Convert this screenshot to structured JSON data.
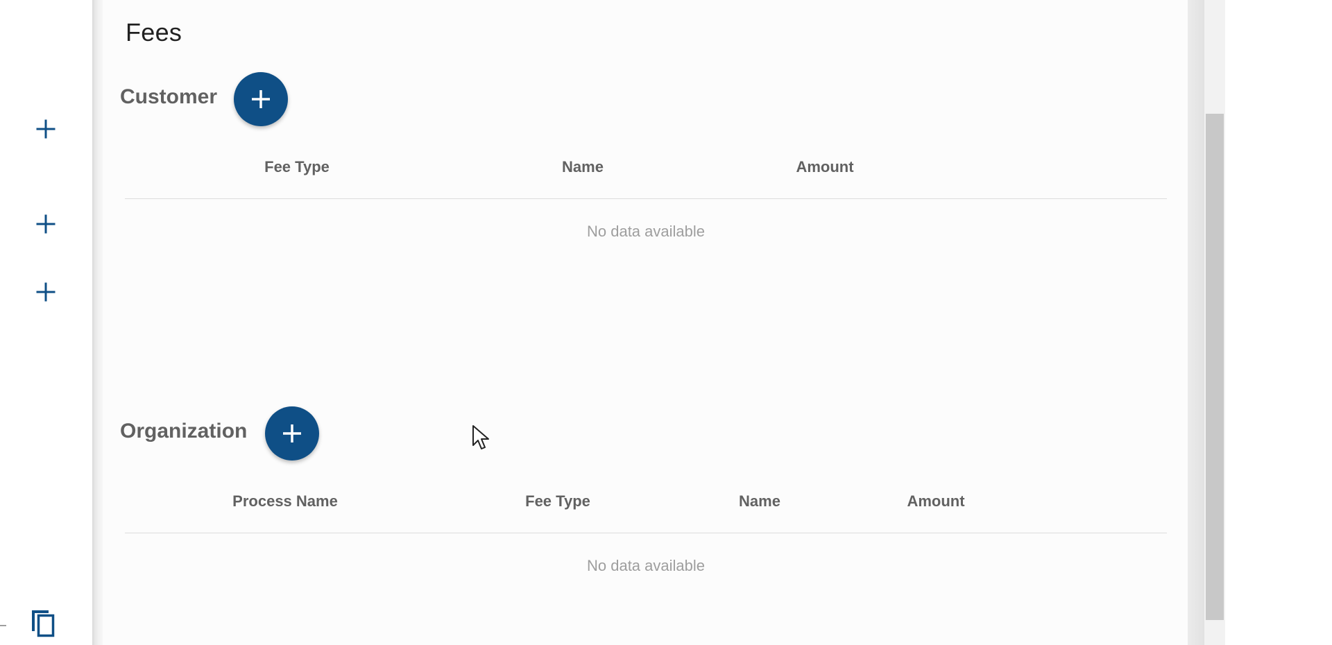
{
  "fees": {
    "title": "Fees",
    "customer": {
      "title": "Customer",
      "columns": [
        "Fee Type",
        "Name",
        "Amount"
      ],
      "empty_text": "No data available"
    },
    "organization": {
      "title": "Organization",
      "columns": [
        "Process Name",
        "Fee Type",
        "Name",
        "Amount"
      ],
      "empty_text": "No data available"
    }
  },
  "icons": {
    "add": "plus-icon",
    "copy": "copy-icon",
    "cursor": "mouse-pointer-icon"
  },
  "colors": {
    "accent": "#0f4f86",
    "header_text": "#616161",
    "empty_text": "#9e9e9e"
  }
}
